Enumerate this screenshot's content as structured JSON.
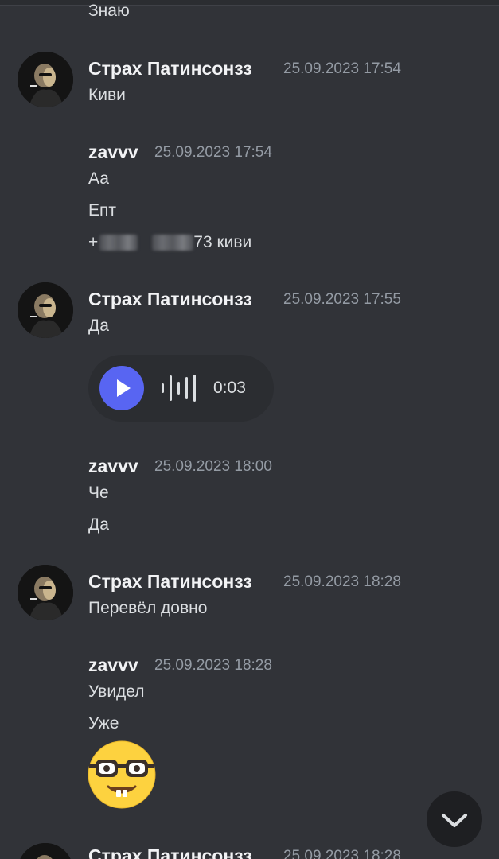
{
  "messages": {
    "prev_line": "Знаю",
    "group1": {
      "author": "Страх Патинсонзз",
      "timestamp": "25.09.2023 17:54",
      "lines": [
        "Киви"
      ]
    },
    "group2": {
      "author": "zavvv",
      "timestamp": "25.09.2023 17:54",
      "lines": [
        "Аа",
        "Епт"
      ],
      "phone_prefix": "+",
      "phone_suffix": "73 киви"
    },
    "group3": {
      "author": "Страх Патинсонзз",
      "timestamp": "25.09.2023 17:55",
      "lines": [
        "Да"
      ],
      "voice_duration": "0:03"
    },
    "group4": {
      "author": "zavvv",
      "timestamp": "25.09.2023 18:00",
      "lines": [
        "Че",
        "Да"
      ]
    },
    "group5": {
      "author": "Страх Патинсонзз",
      "timestamp": "25.09.2023 18:28",
      "lines": [
        "Перевёл довно"
      ]
    },
    "group6": {
      "author": "zavvv",
      "timestamp": "25.09.2023 18:28",
      "lines": [
        "Увидел",
        "Уже"
      ],
      "emoji": "nerd-face"
    },
    "group7": {
      "author": "Страх Патинсонзз",
      "timestamp": "25.09.2023 18:28"
    }
  },
  "icons": {
    "play": "play-icon",
    "waveform": "waveform-icon",
    "scroll_down": "chevron-down-icon"
  },
  "colors": {
    "background": "#313338",
    "accent": "#5865f2",
    "timestamp": "#949ba4"
  }
}
